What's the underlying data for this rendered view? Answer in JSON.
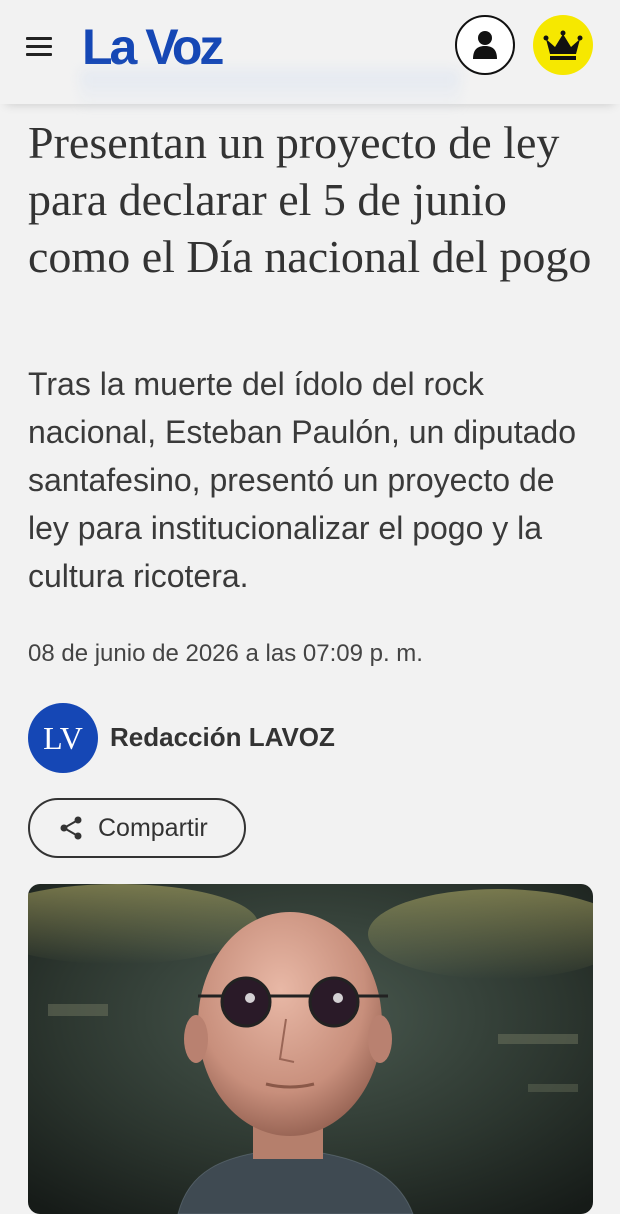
{
  "header": {
    "logo": "La Voz",
    "menu_icon": "hamburger-menu-icon",
    "account_icon": "user-icon",
    "premium_icon": "crown-icon",
    "brand_color": "#1547b5",
    "premium_color": "#f6e800"
  },
  "article": {
    "title": "Presentan un proyecto de ley para declarar el 5 de junio como el Día nacional del pogo",
    "lead": "Tras la muerte del ídolo del rock nacional, Esteban Paulón, un diputado santafesino, presentó un proyecto de ley para institucionalizar el pogo y la cultura ricotera.",
    "date": "08 de junio de 2026 a las 07:09 p. m.",
    "author": {
      "initials": "LV",
      "name": "Redacción LAVOZ"
    },
    "share_label": "Compartir",
    "share_icon": "share-icon"
  }
}
